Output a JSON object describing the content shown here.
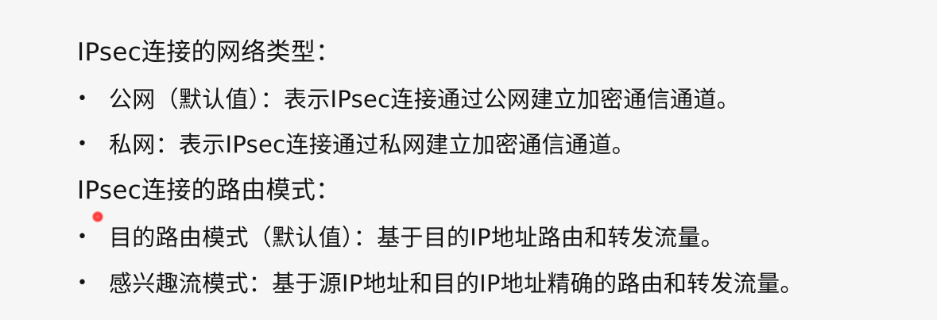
{
  "network_section": {
    "heading": "IPsec连接的网络类型：",
    "items": [
      {
        "bullet": "•",
        "text": "公网（默认值）：表示IPsec连接通过公网建立加密通信通道。"
      },
      {
        "bullet": "•",
        "text": "私网：表示IPsec连接通过私网建立加密通信通道。"
      }
    ]
  },
  "route_section": {
    "heading": "IPsec连接的路由模式：",
    "items": [
      {
        "bullet": "•",
        "text": "目的路由模式（默认值）：基于目的IP地址路由和转发流量。"
      },
      {
        "bullet": "•",
        "text": "感兴趣流模式：基于源IP地址和目的IP地址精确的路由和转发流量。"
      }
    ]
  }
}
